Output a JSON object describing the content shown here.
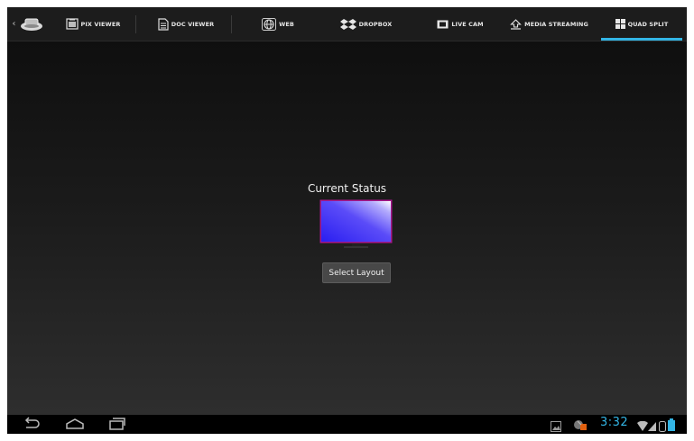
{
  "tabs": [
    {
      "label": "",
      "icon": "app-logo-icon"
    },
    {
      "label": "PIX VIEWER",
      "icon": "picture-icon"
    },
    {
      "label": "DOC VIEWER",
      "icon": "document-icon"
    },
    {
      "label": "WEB",
      "icon": "globe-icon"
    },
    {
      "label": "DROPBOX",
      "icon": "dropbox-icon"
    },
    {
      "label": "LIVE CAM",
      "icon": "camera-icon"
    },
    {
      "label": "MEDIA STREAMING",
      "icon": "streaming-icon"
    },
    {
      "label": "QUAD SPLIT",
      "icon": "quad-split-icon",
      "active": true
    }
  ],
  "main": {
    "status_title": "Current Status",
    "select_layout_label": "Select Layout"
  },
  "system_bar": {
    "time": "3:32",
    "icons": [
      "back-icon",
      "home-icon",
      "recent-apps-icon",
      "gallery-notification-icon",
      "app-notification-icon",
      "wifi-icon",
      "signal-icon",
      "battery-icon"
    ]
  },
  "colors": {
    "accent": "#33b5e5",
    "background": "#111111",
    "monitor_frame": "#a8168c",
    "monitor_screen": "#3a2cf5"
  }
}
